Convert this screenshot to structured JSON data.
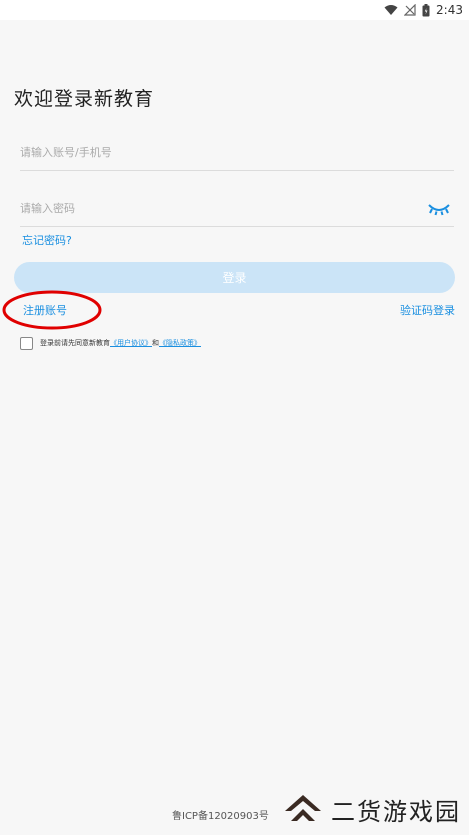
{
  "status_bar": {
    "time": "2:43",
    "icons": [
      "wifi-icon",
      "no-signal-icon",
      "battery-icon"
    ]
  },
  "page": {
    "title": "欢迎登录新教育"
  },
  "form": {
    "account_placeholder": "请输入账号/手机号",
    "password_placeholder": "请输入密码",
    "forgot_label": "忘记密码?",
    "login_label": "登录",
    "register_label": "注册账号",
    "sms_login_label": "验证码登录"
  },
  "agreement": {
    "prefix": "登录前请先同意新教育",
    "user_agreement": "《用户协议》",
    "and": "和",
    "privacy_policy": "《隐私政策》"
  },
  "footer": {
    "icp": "鲁ICP备12020903号"
  },
  "watermark": {
    "text": "二货游戏园"
  },
  "colors": {
    "accent": "#1a8fe0",
    "button_disabled": "#cbe4f7",
    "highlight": "#e00000"
  }
}
